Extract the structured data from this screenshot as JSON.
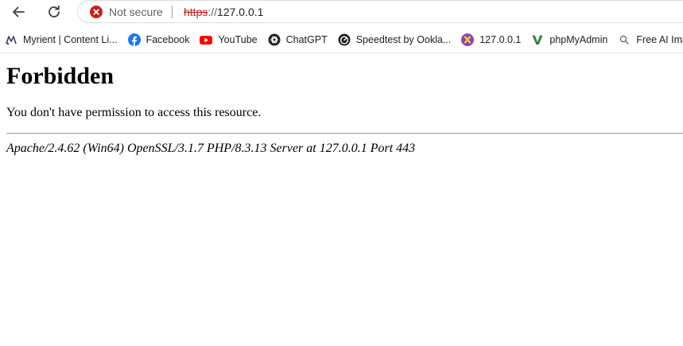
{
  "browser": {
    "security_label": "Not secure",
    "url_scheme": "https",
    "url_sep": "://",
    "url_host": "127.0.0.1",
    "colors": {
      "insecure_red": "#c5221f",
      "chrome_gray": "#5f6368"
    }
  },
  "bookmarks": [
    {
      "label": "Myrient | Content Li...",
      "icon": "myrient-icon"
    },
    {
      "label": "Facebook",
      "icon": "facebook-icon"
    },
    {
      "label": "YouTube",
      "icon": "youtube-icon"
    },
    {
      "label": "ChatGPT",
      "icon": "chatgpt-icon"
    },
    {
      "label": "Speedtest by Ookla...",
      "icon": "speedtest-icon"
    },
    {
      "label": "127.0.0.1",
      "icon": "xampp-icon"
    },
    {
      "label": "phpMyAdmin",
      "icon": "phpmyadmin-icon"
    },
    {
      "label": "Free AI Image",
      "icon": "search-icon"
    }
  ],
  "page": {
    "heading": "Forbidden",
    "message": "You don't have permission to access this resource.",
    "server_signature": "Apache/2.4.62 (Win64) OpenSSL/3.1.7 PHP/8.3.13 Server at 127.0.0.1 Port 443"
  }
}
